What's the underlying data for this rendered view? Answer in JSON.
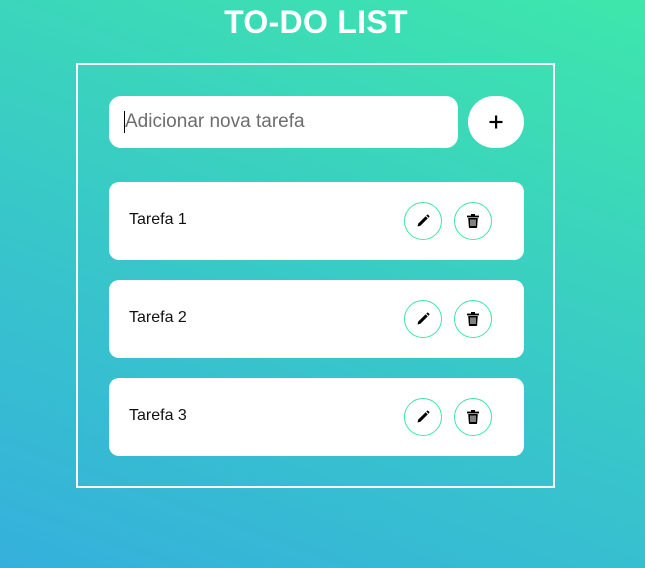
{
  "header": {
    "title": "TO-DO LIST"
  },
  "new_task": {
    "placeholder": "Adicionar nova tarefa",
    "value": "",
    "add_button_icon": "plus-icon"
  },
  "tasks": [
    {
      "label": "Tarefa 1",
      "edit_icon": "pencil-icon",
      "delete_icon": "trash-icon"
    },
    {
      "label": "Tarefa 2",
      "edit_icon": "pencil-icon",
      "delete_icon": "trash-icon"
    },
    {
      "label": "Tarefa 3",
      "edit_icon": "pencil-icon",
      "delete_icon": "trash-icon"
    }
  ],
  "colors": {
    "gradient_start": "#35b0dc",
    "gradient_end": "#3ee7ab",
    "accent_border": "#3ee6a5",
    "panel_border": "#ffffff"
  }
}
